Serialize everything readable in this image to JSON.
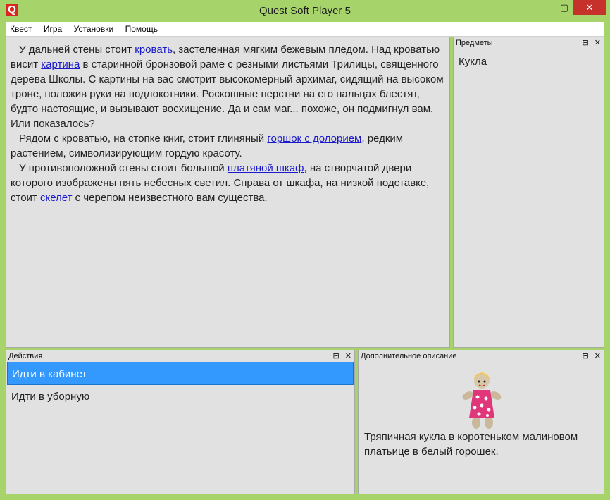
{
  "window": {
    "title": "Quest Soft Player 5",
    "icon_letter": "Q",
    "min_glyph": "—",
    "max_glyph": "▢",
    "close_glyph": "✕"
  },
  "menu": [
    "Квест",
    "Игра",
    "Установки",
    "Помощь"
  ],
  "main": {
    "paragraphs": [
      [
        {
          "t": "У дальней стены стоит "
        },
        {
          "t": "кровать",
          "link": true
        },
        {
          "t": ", застеленная мягким бежевым пледом. Над кроватью висит "
        },
        {
          "t": "картина",
          "link": true
        },
        {
          "t": " в старинной бронзовой раме с резными листьями Трилицы, священного дерева Школы. С картины на вас смотрит высокомерный архимаг, сидящий на высоком троне, положив руки на подлокотники. Роскошные перстни на его пальцах блестят, будто настоящие, и вызывают восхищение. Да и сам маг... похоже, он подмигнул вам. Или показалось?"
        }
      ],
      [
        {
          "t": "Рядом с кроватью, на стопке книг, стоит глиняный "
        },
        {
          "t": "горшок с долорием",
          "link": true
        },
        {
          "t": ", редким растением, символизирующим гордую красоту."
        }
      ],
      [
        {
          "t": "У противоположной стены стоит большой "
        },
        {
          "t": "платяной шкаф",
          "link": true
        },
        {
          "t": ", на створчатой двери которого изображены пять небесных светил. Справа от шкафа, на низкой подставке, стоит "
        },
        {
          "t": "скелет",
          "link": true
        },
        {
          "t": " с черепом неизвестного вам существа."
        }
      ]
    ]
  },
  "items_panel": {
    "title": "Предметы",
    "items": [
      "Кукла"
    ]
  },
  "actions_panel": {
    "title": "Действия",
    "items": [
      {
        "label": "Идти в кабинет",
        "selected": true
      },
      {
        "label": "Идти в уборную",
        "selected": false
      }
    ]
  },
  "extra_panel": {
    "title": "Дополнительное описание",
    "text": "Тряпичная кукла в коротеньком малиновом платьице в белый горошек."
  },
  "panel_buttons": {
    "float": "⊟",
    "close": "✕"
  },
  "colors": {
    "accent_selection": "#3399ff",
    "link": "#1a1acc",
    "frame": "#a7d36b",
    "close_button": "#c7312b"
  }
}
